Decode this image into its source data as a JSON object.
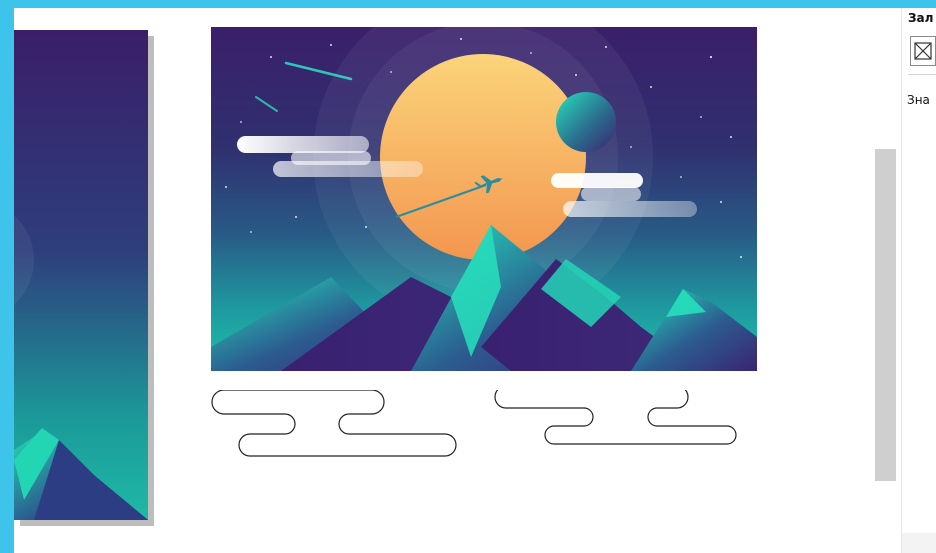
{
  "panel": {
    "title": "Зал",
    "value_label": "Зна",
    "swatch_icon": "no-fill-icon"
  },
  "colors": {
    "sky_top": "#3a1f6b",
    "sky_bottom": "#1fb5a3",
    "sun_light": "#fad27a",
    "sun_dark": "#f59a55",
    "mountain_teal": "#1ed6b5",
    "mountain_purple": "#3b2473",
    "accent_frame": "#3ec3ea"
  }
}
